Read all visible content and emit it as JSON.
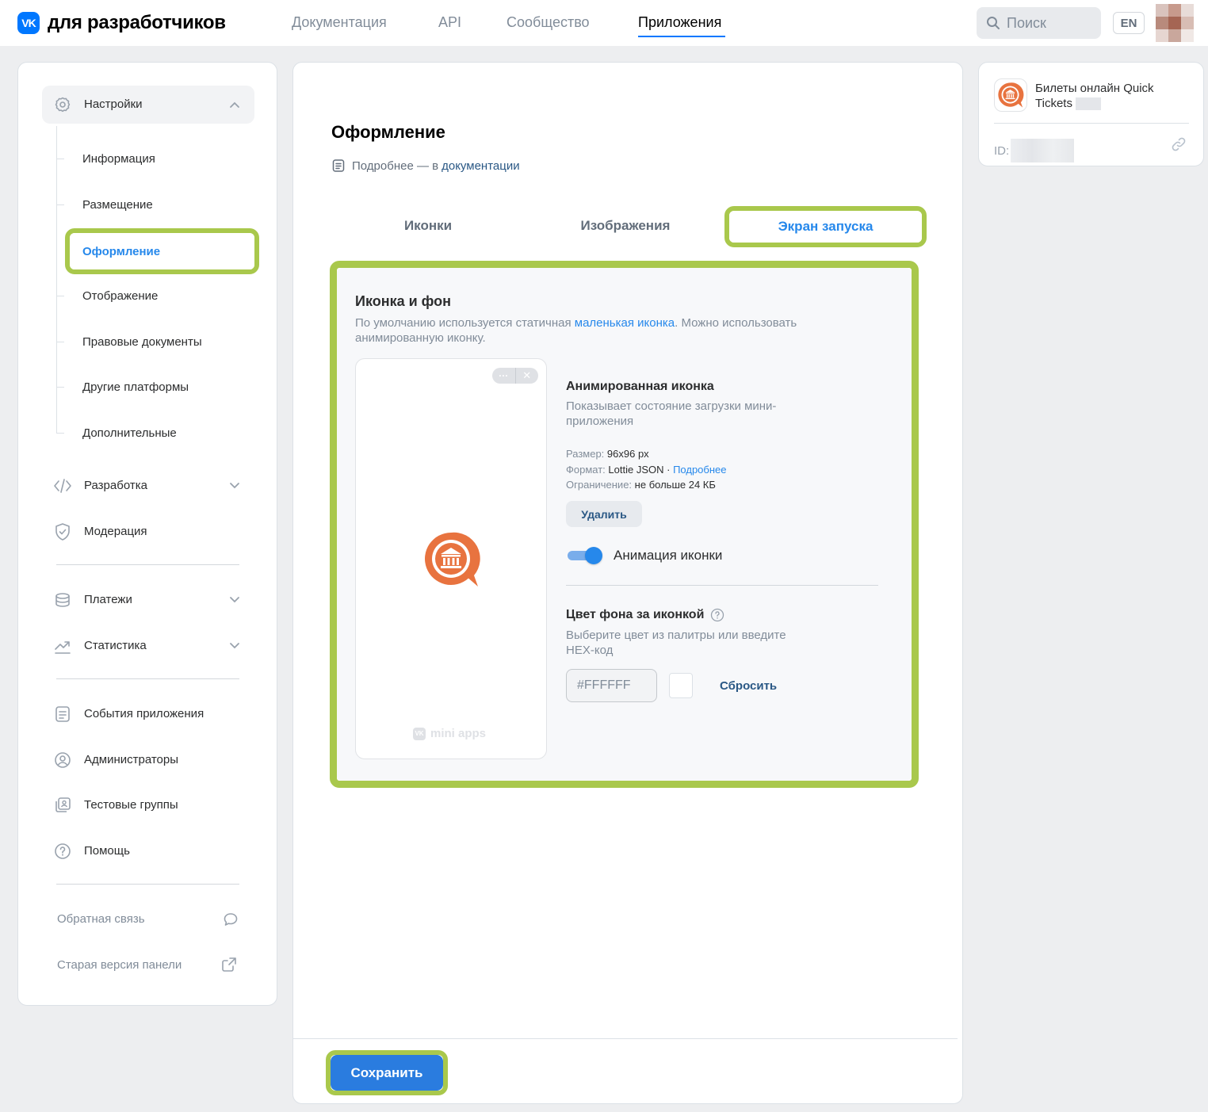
{
  "header": {
    "logo_text": "для разработчиков",
    "nav": [
      "Документация",
      "API",
      "Сообщество",
      "Приложения"
    ],
    "search_placeholder": "Поиск",
    "lang": "EN"
  },
  "sidebar": {
    "settings_label": "Настройки",
    "sub_items": [
      "Информация",
      "Размещение",
      "Оформление",
      "Отображение",
      "Правовые документы",
      "Другие платформы",
      "Дополнительные"
    ],
    "sections": {
      "dev": "Разработка",
      "moderation": "Модерация",
      "payments": "Платежи",
      "stats": "Статистика",
      "events": "События приложения",
      "admins": "Администраторы",
      "test_groups": "Тестовые группы",
      "help": "Помощь"
    },
    "footer": {
      "feedback": "Обратная связь",
      "old_panel": "Старая версия панели"
    }
  },
  "main": {
    "title": "Оформление",
    "doc_prefix": "Подробнее — в",
    "doc_link": "документации",
    "tabs": [
      "Иконки",
      "Изображения",
      "Экран запуска"
    ],
    "panel": {
      "title": "Иконка и фон",
      "desc_prefix": "По умолчанию используется статичная",
      "desc_link": "маленькая иконка",
      "desc_suffix_line1": ". Можно использовать",
      "desc_line2": "анимированную иконку.",
      "phone_footer": "mini apps",
      "anim_title": "Анимированная иконка",
      "anim_desc_line1": "Показывает состояние загрузки мини-",
      "anim_desc_line2": "приложения",
      "size_label": "Размер:",
      "size_value": "96x96 px",
      "format_label": "Формат:",
      "format_value": "Lottie JSON ·",
      "format_link": "Подробнее",
      "limit_label": "Ограничение:",
      "limit_value": "не больше 24 КБ",
      "delete_label": "Удалить",
      "toggle_label": "Анимация иконки",
      "toggle_on": true,
      "bg_title": "Цвет фона за иконкой",
      "bg_desc_line1": "Выберите цвет из палитры или введите",
      "bg_desc_line2": "HEX-код",
      "hex_value": "#FFFFFF",
      "reset_label": "Сбросить"
    },
    "save_label": "Сохранить"
  },
  "app_card": {
    "name_line1": "Билеты онлайн Quick",
    "name_line2": "Tickets",
    "id_label": "ID:"
  },
  "colors": {
    "accent": "#2688eb",
    "brand": "#0077ff",
    "highlight": "#a9c84c",
    "app_icon": "#e8733f"
  }
}
